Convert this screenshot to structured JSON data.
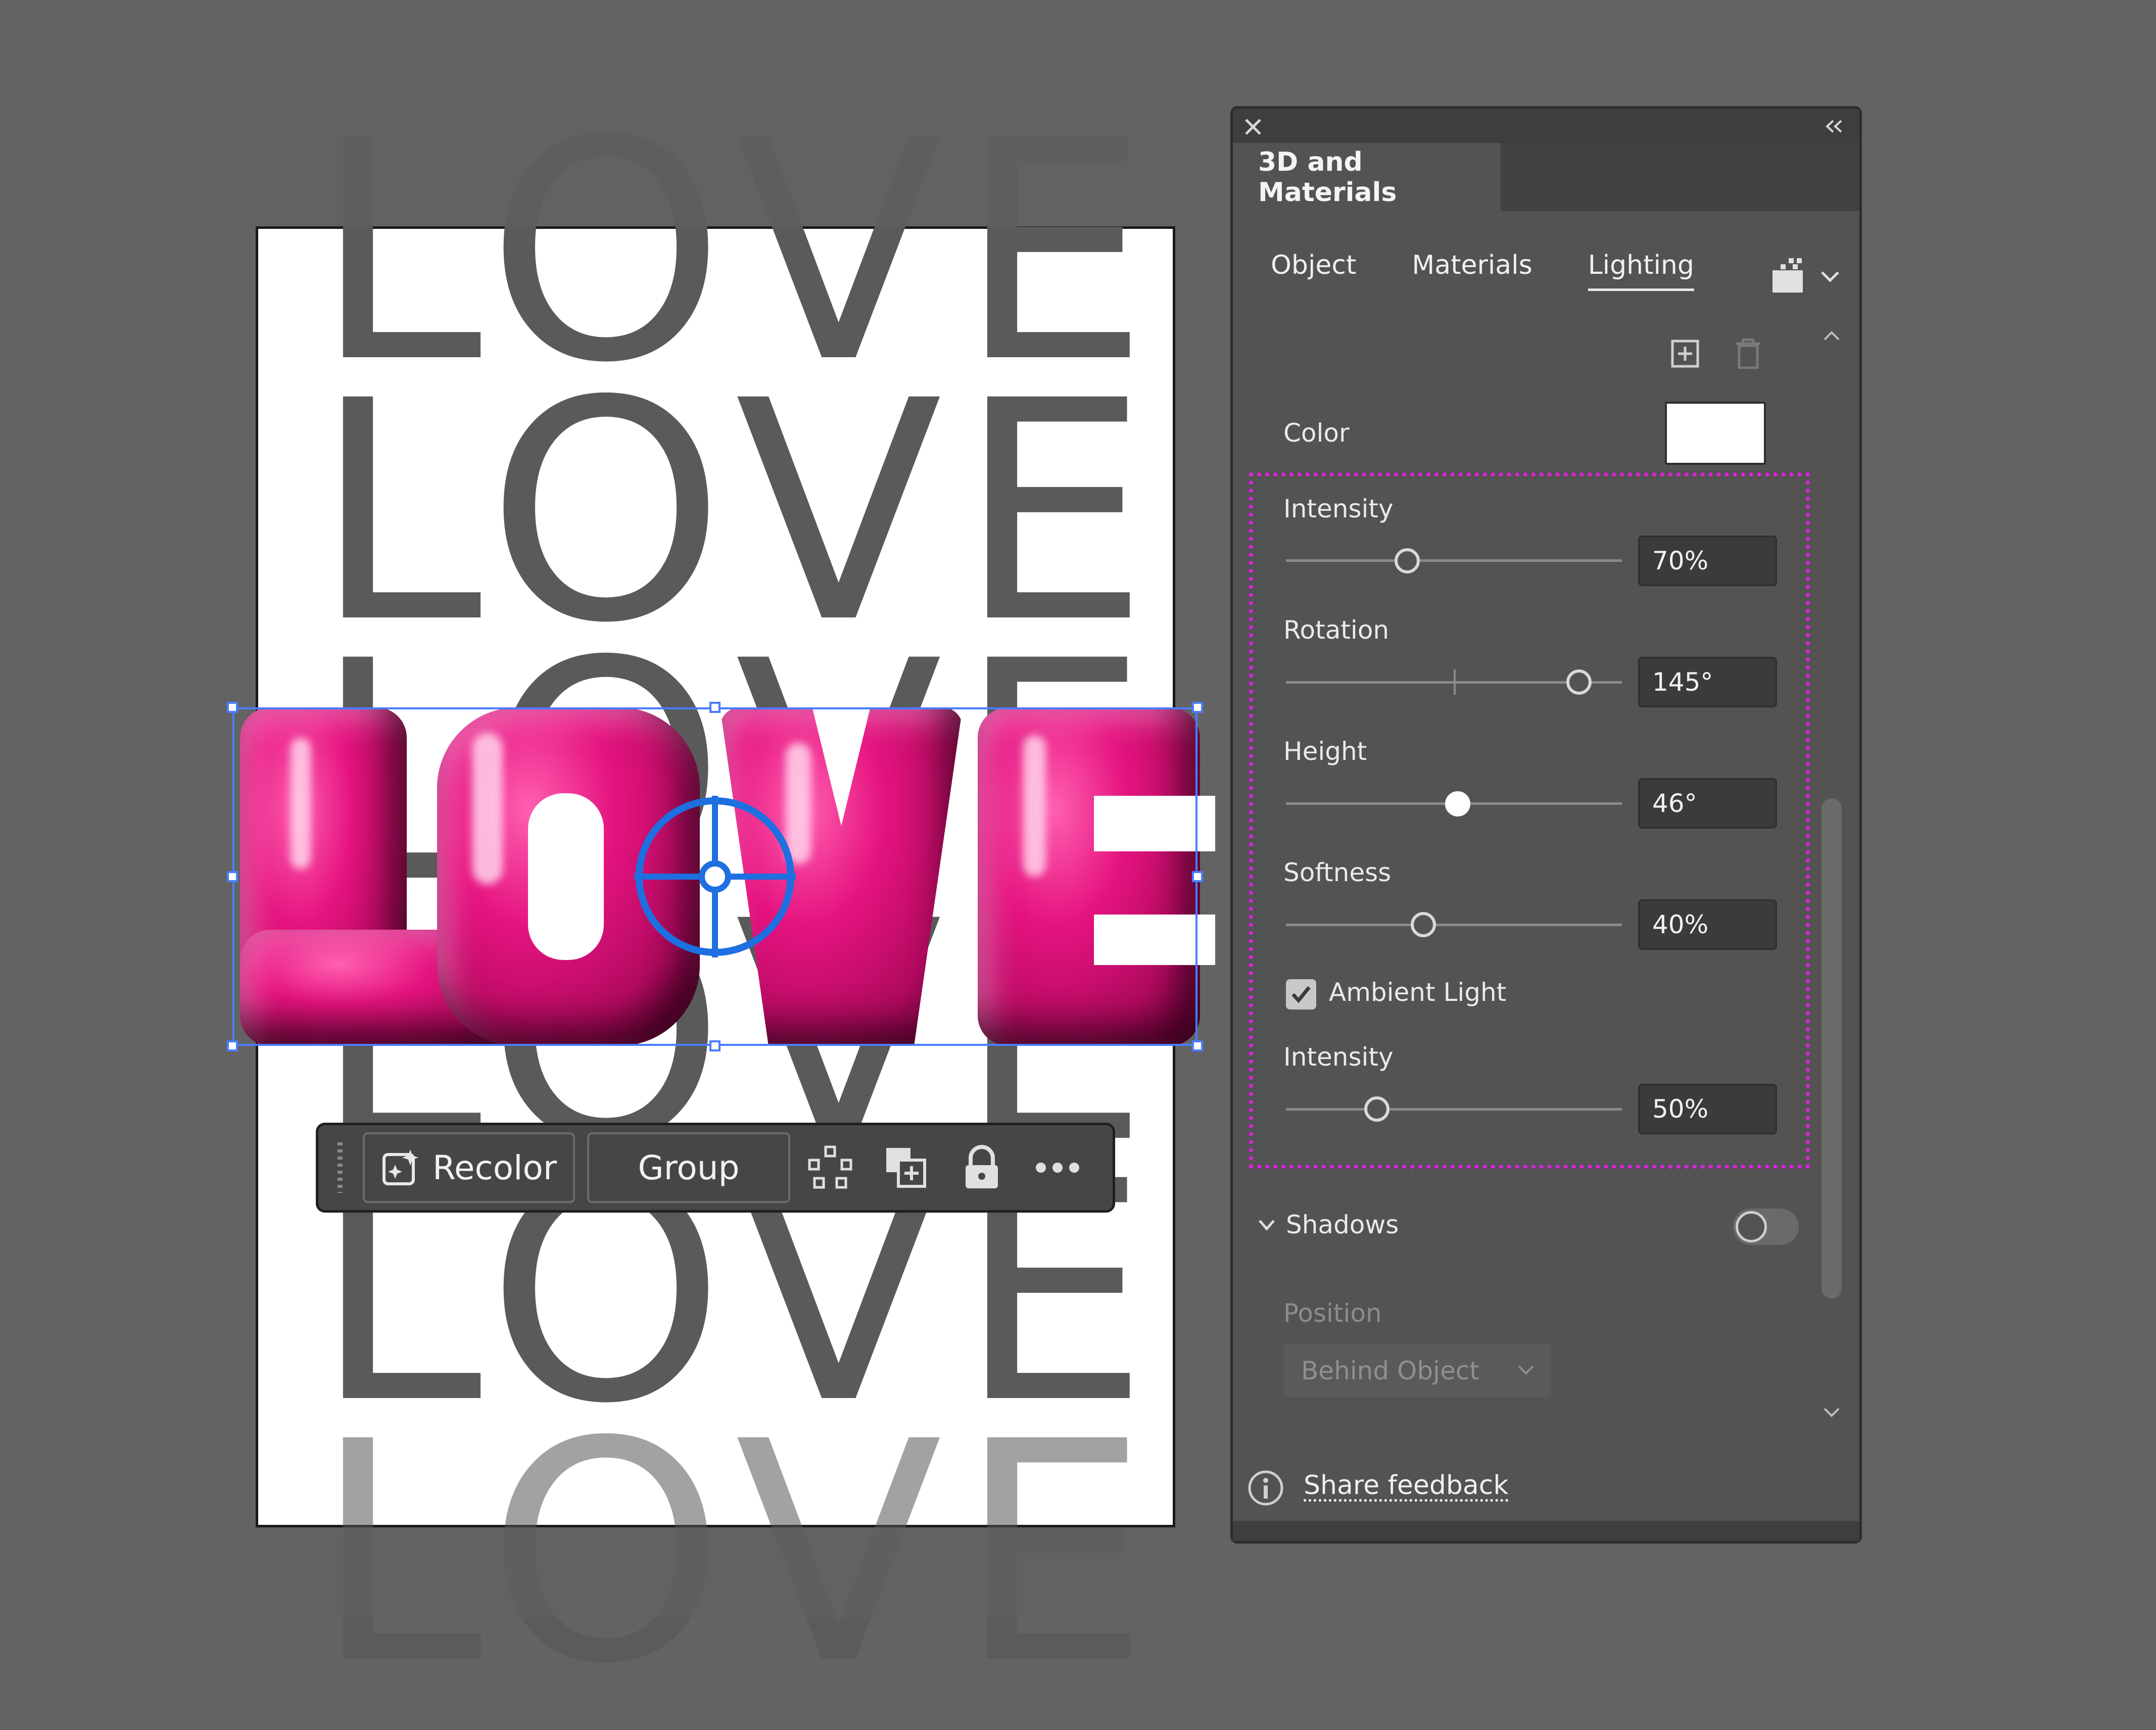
{
  "artwork": {
    "background_word": "LOVE",
    "featured_word": "LOVE",
    "letter_color": "#e5137f"
  },
  "context_toolbar": {
    "recolor_label": "Recolor",
    "group_label": "Group"
  },
  "panel": {
    "title": "3D and Materials",
    "tabs": [
      {
        "label": "Object",
        "active": false
      },
      {
        "label": "Materials",
        "active": false
      },
      {
        "label": "Lighting",
        "active": true
      }
    ],
    "color_label": "Color",
    "color_value": "#ffffff",
    "intensity": {
      "label": "Intensity",
      "value": "70%",
      "level": 0.36
    },
    "rotation": {
      "label": "Rotation",
      "value": "145°",
      "level": 0.86
    },
    "height": {
      "label": "Height",
      "value": "46°",
      "level": 0.51
    },
    "softness": {
      "label": "Softness",
      "value": "40%",
      "level": 0.41
    },
    "ambient_light": {
      "label": "Ambient Light",
      "checked": true
    },
    "ambient_intensity": {
      "label": "Intensity",
      "value": "50%",
      "level": 0.27
    },
    "shadows": {
      "label": "Shadows",
      "enabled": false
    },
    "position": {
      "label": "Position",
      "selected": "Behind Object"
    },
    "feedback_link": "Share feedback"
  }
}
